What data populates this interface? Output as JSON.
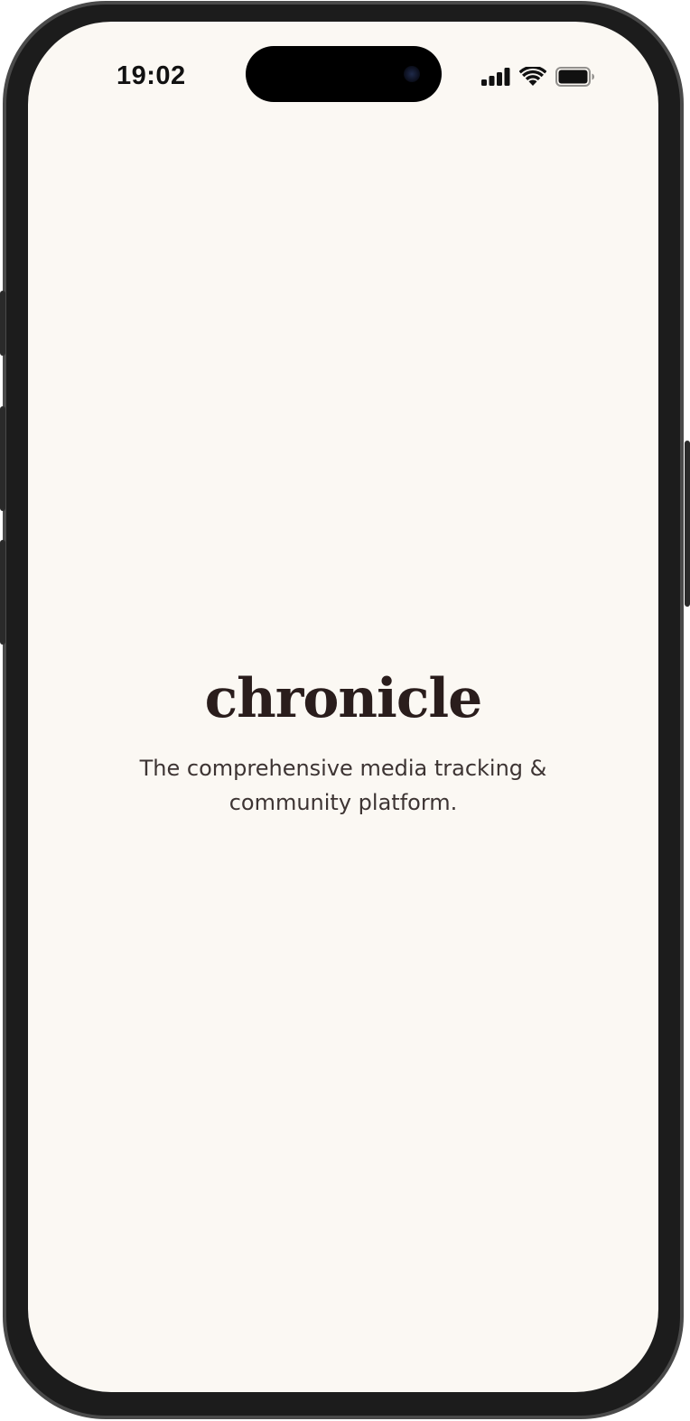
{
  "status_bar": {
    "time": "19:02",
    "icons": [
      "cellular-signal-icon",
      "wifi-icon",
      "battery-icon"
    ]
  },
  "splash": {
    "wordmark": "chronicle",
    "tagline_line1": "The comprehensive media tracking &",
    "tagline_line2": "community platform."
  },
  "colors": {
    "background": "#fbf8f3",
    "wordmark": "#2a1d1c",
    "tagline": "#3d3433",
    "device_frame": "#1c1c1c"
  }
}
